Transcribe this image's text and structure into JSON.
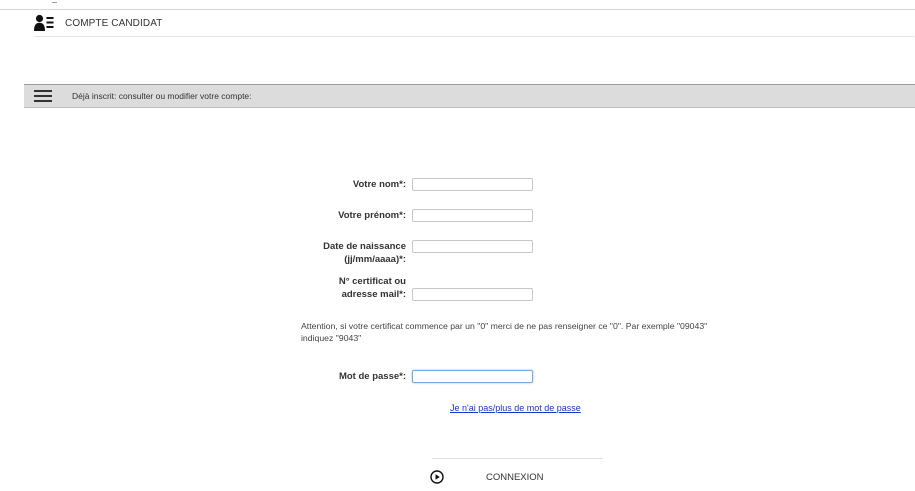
{
  "header": {
    "title": "COMPTE CANDIDAT",
    "icon": "user-list-icon"
  },
  "section": {
    "menu_icon": "hamburger-icon",
    "title": "Déjà inscrit: consulter ou modifier votre compte:"
  },
  "form": {
    "nom": {
      "label": "Votre nom*:",
      "value": ""
    },
    "prenom": {
      "label": "Votre prénom*:",
      "value": ""
    },
    "naissance": {
      "label_line1": "Date de naissance",
      "label_line2": "(jj/mm/aaaa)*:",
      "value": ""
    },
    "certificat": {
      "label_line1": "N° certificat ou",
      "label_line2": "adresse mail*:",
      "value": ""
    },
    "note": "Attention, si votre certificat commence par un \"0\" merci de ne pas renseigner ce \"0\". Par exemple \"09043\" indiquez \"9043\"",
    "password": {
      "label": "Mot de passe*:",
      "value": ""
    },
    "forgot_link": "Je n'ai pas/plus de mot de passe"
  },
  "footer": {
    "button_icon": "play-circle-icon",
    "button_label": "CONNEXION"
  },
  "colors": {
    "link": "#1a35c9",
    "bar_background": "#dcdcdc",
    "focus_border": "#7ba9dc"
  }
}
